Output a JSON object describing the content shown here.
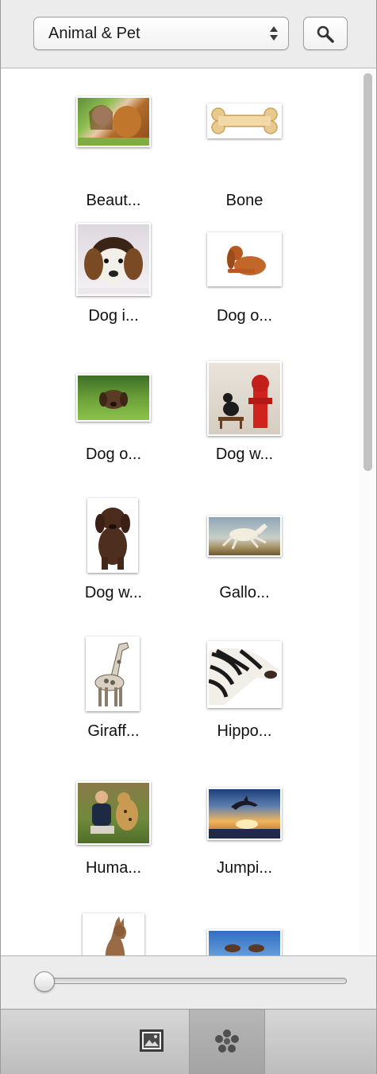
{
  "toolbar": {
    "category": "Animal & Pet",
    "updown_icon": "select-updown-icon",
    "search_icon": "magnifier-icon"
  },
  "items": [
    {
      "label": "Beaut...",
      "image": "woman-and-golden-retriever"
    },
    {
      "label": "Bone",
      "image": "dog-bone"
    },
    {
      "label": "Dog i...",
      "image": "beagle-puppy"
    },
    {
      "label": "Dog o...",
      "image": "red-spaniel-lying"
    },
    {
      "label": "Dog o...",
      "image": "puppy-in-grass"
    },
    {
      "label": "Dog w...",
      "image": "dog-with-hydrant"
    },
    {
      "label": "Dog w...",
      "image": "chocolate-labrador"
    },
    {
      "label": "Gallo...",
      "image": "galloping-horse"
    },
    {
      "label": "Giraff...",
      "image": "giraffe"
    },
    {
      "label": "Hippo...",
      "image": "zebra-head"
    },
    {
      "label": "Huma...",
      "image": "man-with-cheetah"
    },
    {
      "label": "Jumpi...",
      "image": "jumping-dolphin"
    },
    {
      "label": "",
      "image": "kangaroo"
    },
    {
      "label": "",
      "image": "kangaroos-sky"
    }
  ],
  "slider": {
    "value_fraction": 0.0
  },
  "tabs": [
    {
      "name": "photos-tab",
      "icon": "picture-icon",
      "selected": false
    },
    {
      "name": "shapes-tab",
      "icon": "flower-shapes-icon",
      "selected": true
    }
  ],
  "colors": {
    "panel_bg": "#ececec",
    "content_bg": "#ffffff",
    "selected_tab": "#a9a9a9"
  }
}
